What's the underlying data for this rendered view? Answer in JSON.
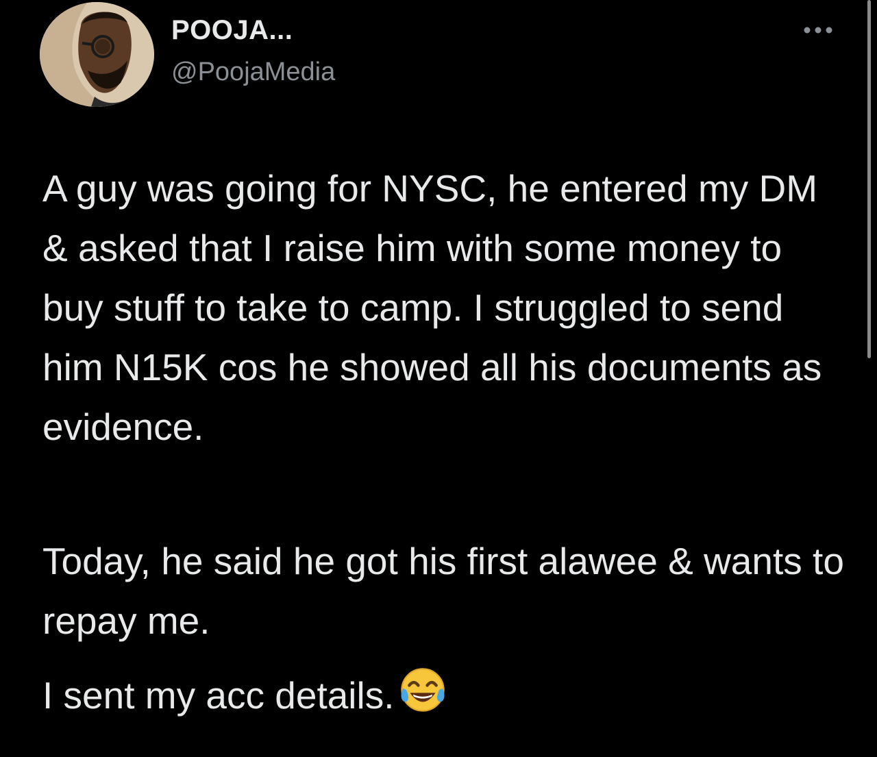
{
  "tweet": {
    "display_name": "POOJA...",
    "handle": "@PoojaMedia",
    "more_icon": "more-horizontal-icon",
    "paragraphs": [
      "A guy was going for NYSC, he entered my DM & asked that I raise him with some money to buy stuff to take to camp. I struggled to send him N15K cos he showed all his documents as evidence.",
      "Today, he said he got his first alawee & wants to repay me.",
      "I sent my acc details."
    ],
    "emoji": "face-with-tears-of-joy-emoji"
  },
  "colors": {
    "background": "#000000",
    "text_primary": "#e7e9ea",
    "text_secondary": "#8b9096",
    "emoji_face": "#f7c63b"
  }
}
